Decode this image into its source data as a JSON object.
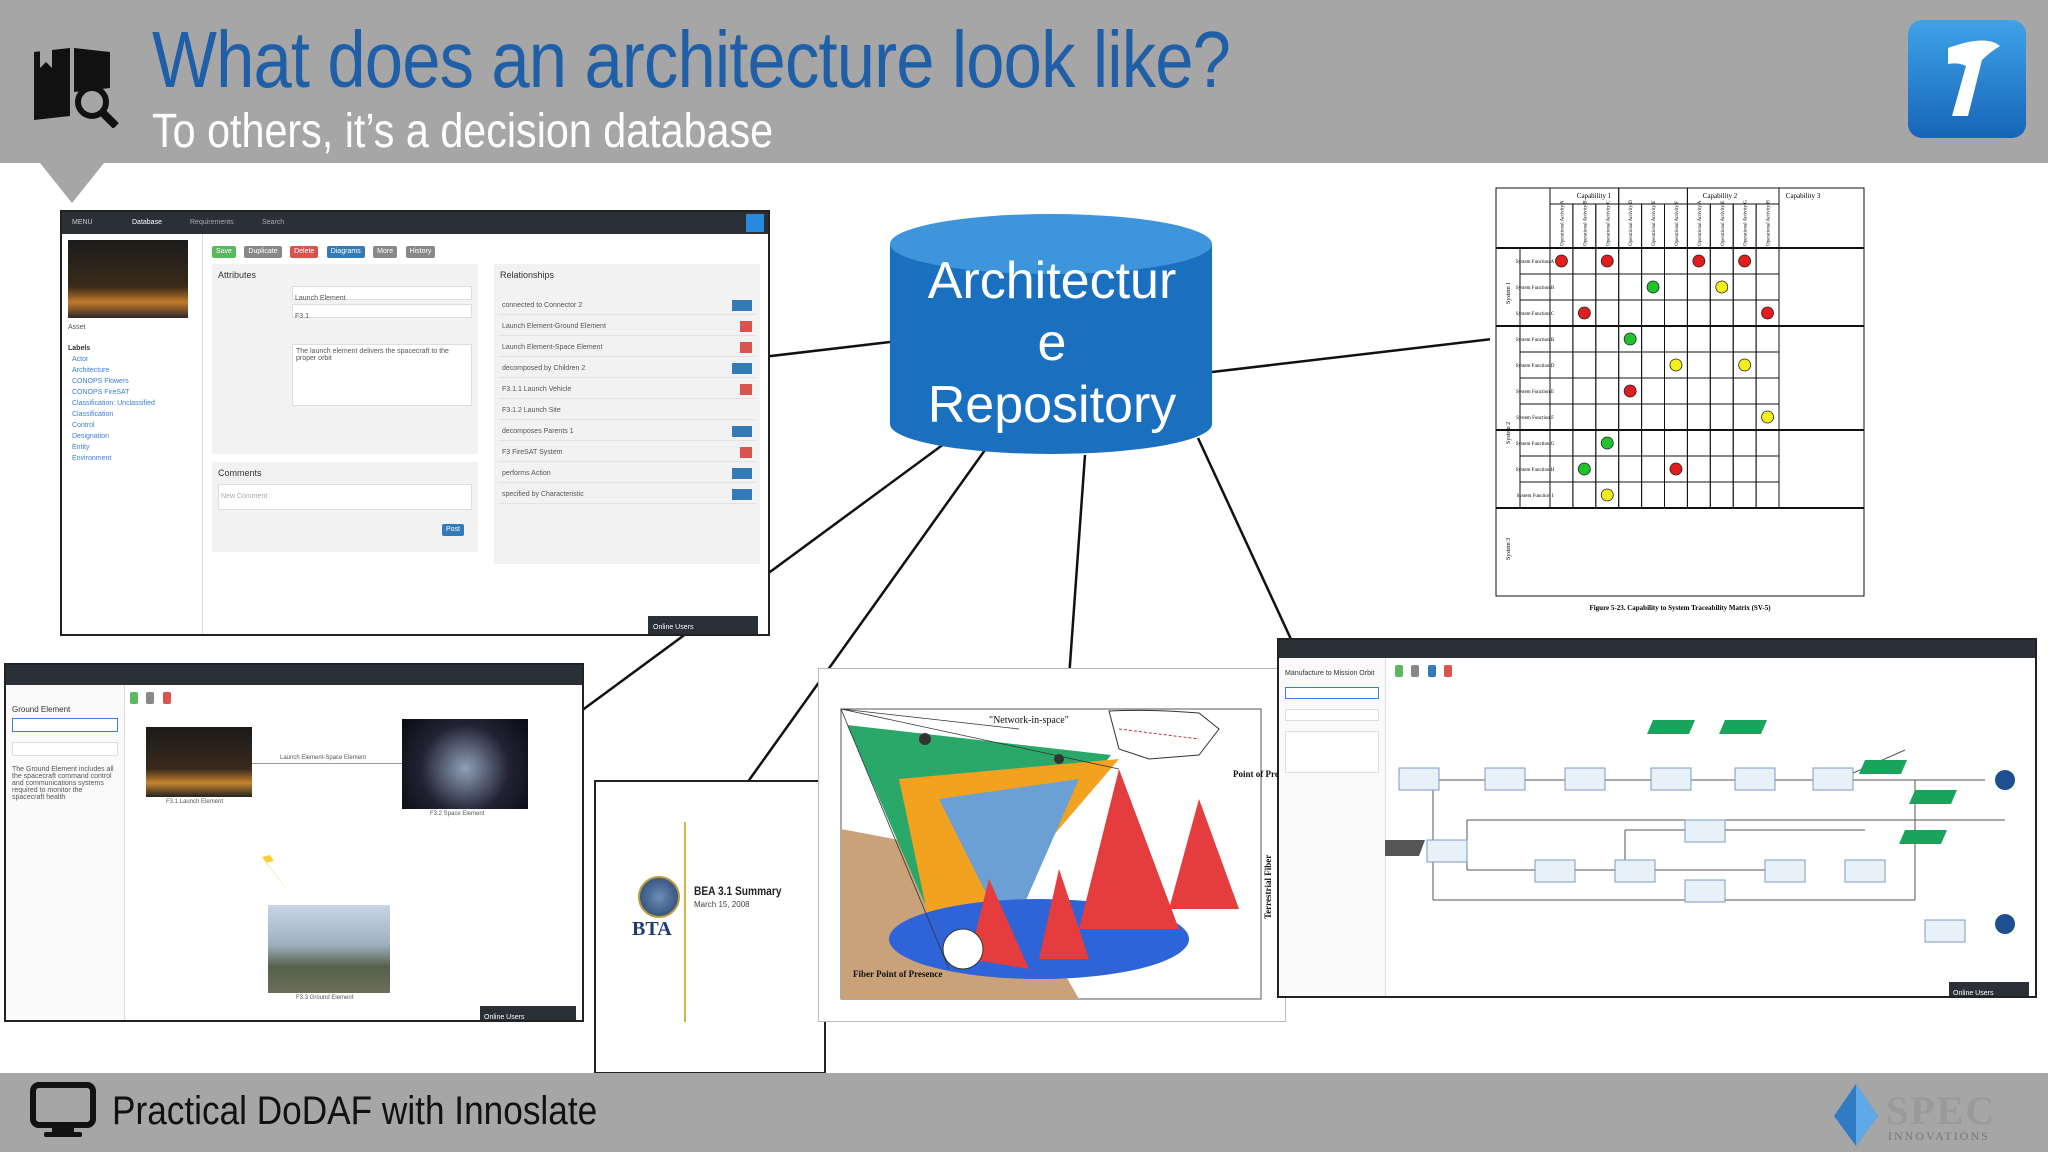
{
  "header": {
    "title": "What does an architecture look like?",
    "subtitle": "To others, it’s a decision database"
  },
  "footer": {
    "text": "Practical DoDAF with Innoslate",
    "brand": "SPEC",
    "brand_sub": "INNOVATIONS"
  },
  "repository": {
    "label_lines": [
      "Architectur",
      "e",
      "Repository"
    ]
  },
  "colors": {
    "header_bg": "#a6a6a6",
    "title": "#1f5fa8",
    "repository": "#1a6fbf",
    "repository_top": "#3f95dc"
  },
  "screen1": {
    "menu": "MENU",
    "nav": [
      "Database",
      "Requirements",
      "Search"
    ],
    "actions": [
      "Save",
      "Duplicate",
      "Delete",
      "Diagrams",
      "More",
      "History"
    ],
    "attributes_label": "Attributes",
    "relationships_label": "Relationships",
    "comments_label": "Comments",
    "name_value": "Launch Element",
    "number_value": "F3.1",
    "description": "The launch element delivers the spacecraft to the proper orbit",
    "comment_placeholder": "New Comment",
    "post_button": "Post",
    "class": "Asset",
    "labels_header": "Labels",
    "labels": [
      "Actor",
      "Architecture",
      "CONOPS Flowers",
      "CONOPS FireSAT",
      "Classification: Unclassified",
      "Classification",
      "Control",
      "Designation",
      "Entity",
      "Environment"
    ],
    "relationship_rows": [
      "connected to Connector 2",
      "Launch Element-Ground Element",
      "Launch Element-Space Element",
      "decomposed by Children 2",
      "F3.1.1 Launch Vehicle",
      "F3.1.2 Launch Site",
      "decomposes Parents 1",
      "F3 FireSAT System",
      "performs Action",
      "specified by Characteristic"
    ],
    "online_users": "Online Users"
  },
  "screen2": {
    "title_field": "Ground Element",
    "description": "The Ground Element includes all the spacecraft command control and communications systems required to monitor the spacecraft health",
    "nodes": [
      "F3.1 Launch Element",
      "F3.2 Space Element",
      "F3.3 Ground Element"
    ],
    "edge_label": "Launch Element-Space Element",
    "online_users": "Online Users"
  },
  "bta": {
    "title": "BEA 3.1 Summary",
    "date": "March 15, 2008",
    "logo_text": "BTA"
  },
  "network": {
    "label_network": "\"Network-in-space\"",
    "label_pop": "Point of Presence",
    "label_fiber": "Fiber Point of Presence",
    "label_terrestrial": "Terrestrial Fiber"
  },
  "matrix": {
    "capabilities": [
      "Capability 1",
      "Capability 2",
      "Capability 3"
    ],
    "activities": [
      "Operational Activity A",
      "Operational Activity B",
      "Operational Activity C",
      "Operational Activity D",
      "Operational Activity E",
      "Operational Activity F",
      "Operational Activity A",
      "Operational Activity E",
      "Operational Activity G",
      "Operational Activity H"
    ],
    "systems": [
      "System 1",
      "System 2",
      "System 3"
    ],
    "functions": [
      "System Function A",
      "System Function B",
      "System Function C",
      "System Function B",
      "System Function D",
      "System Function E",
      "System Function F",
      "System Function G",
      "System Function H",
      "System Function I"
    ],
    "caption": "Figure 5-23. Capability to System Traceability Matrix (SV-5)",
    "dots": [
      {
        "row": 0,
        "col": 0,
        "color": "red"
      },
      {
        "row": 0,
        "col": 2,
        "color": "red"
      },
      {
        "row": 0,
        "col": 6,
        "color": "red"
      },
      {
        "row": 0,
        "col": 8,
        "color": "red"
      },
      {
        "row": 1,
        "col": 4,
        "color": "green"
      },
      {
        "row": 1,
        "col": 7,
        "color": "yellow"
      },
      {
        "row": 2,
        "col": 1,
        "color": "red"
      },
      {
        "row": 2,
        "col": 9,
        "color": "red"
      },
      {
        "row": 3,
        "col": 3,
        "color": "green"
      },
      {
        "row": 4,
        "col": 5,
        "color": "yellow"
      },
      {
        "row": 4,
        "col": 8,
        "color": "yellow"
      },
      {
        "row": 5,
        "col": 3,
        "color": "red"
      },
      {
        "row": 6,
        "col": 9,
        "color": "yellow"
      },
      {
        "row": 7,
        "col": 2,
        "color": "green"
      },
      {
        "row": 8,
        "col": 1,
        "color": "green"
      },
      {
        "row": 8,
        "col": 5,
        "color": "red"
      },
      {
        "row": 9,
        "col": 2,
        "color": "yellow"
      }
    ]
  },
  "screen4": {
    "title_field": "Manufacture to Mission Orbit",
    "online_users": "Online Users"
  }
}
